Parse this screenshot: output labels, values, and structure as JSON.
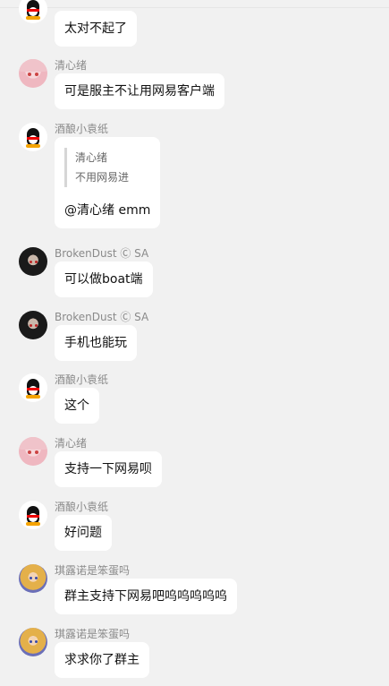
{
  "messages": [
    {
      "name": "",
      "text": "太对不起了",
      "avatar": "qq-penguin-avatar"
    },
    {
      "name": "清心绪",
      "text": "可是服主不让用网易客户端",
      "avatar": "anime-pink-hair-avatar"
    },
    {
      "name": "酒酿小袁纸",
      "quote": {
        "author": "清心绪",
        "text": "不用网易进"
      },
      "text": "@清心绪 emm",
      "avatar": "qq-penguin-avatar"
    },
    {
      "name": "BrokenDust Ⓒ SA",
      "text": "可以做boat端",
      "avatar": "anime-dark-hair-avatar"
    },
    {
      "name": "BrokenDust Ⓒ SA",
      "text": "手机也能玩",
      "avatar": "anime-dark-hair-avatar"
    },
    {
      "name": "酒酿小袁纸",
      "text": "这个",
      "avatar": "qq-penguin-avatar"
    },
    {
      "name": "清心绪",
      "text": "支持一下网易呗",
      "avatar": "anime-pink-hair-avatar"
    },
    {
      "name": "酒酿小袁纸",
      "text": "好问题",
      "avatar": "qq-penguin-avatar"
    },
    {
      "name": "琪露诺是笨蛋吗",
      "text": "群主支持下网易吧呜呜呜呜呜",
      "avatar": "anime-blonde-avatar"
    },
    {
      "name": "琪露诺是笨蛋吗",
      "text": "求求你了群主",
      "avatar": "anime-blonde-avatar"
    }
  ]
}
